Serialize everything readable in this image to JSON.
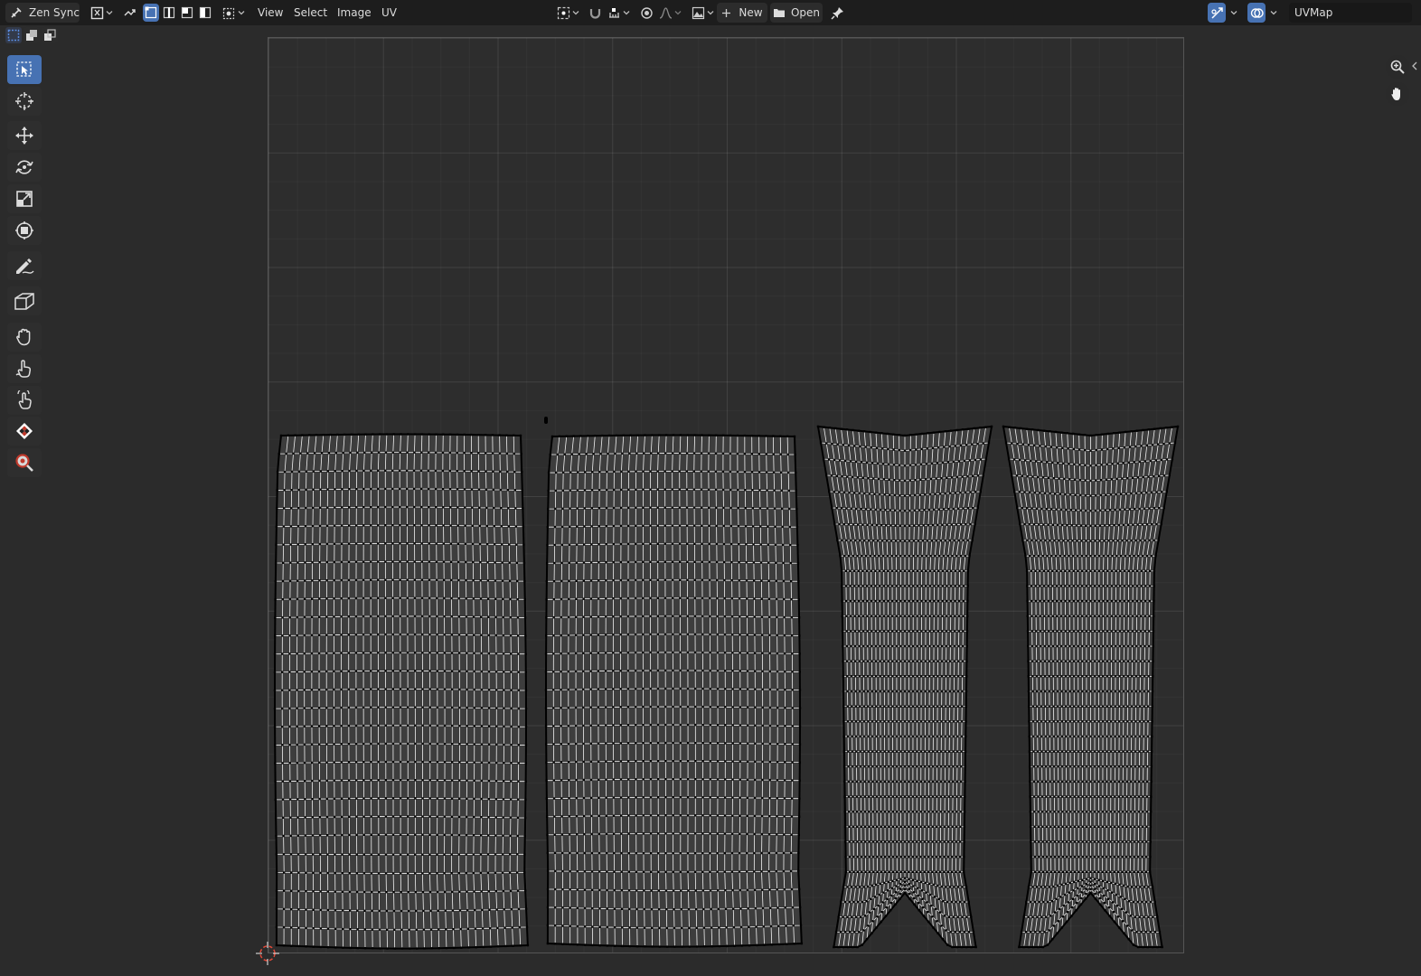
{
  "header": {
    "editor_name": "Zen Sync",
    "menus": [
      "View",
      "Select",
      "Image",
      "UV"
    ],
    "image_new_label": "New",
    "image_open_label": "Open",
    "uv_map_name": "UVMap"
  },
  "colors": {
    "header_bg": "#1d1d1d",
    "viewport_bg": "#2b2b2b",
    "active_tool": "#4772b3",
    "uv_face_fill": "#3d3d3d",
    "uv_edge": "#f0f0f0",
    "uv_vertex": "#000000",
    "cursor": "#e04a3a"
  },
  "toolbar": {
    "tools": [
      "select-box-tool",
      "cursor-tool",
      "move-tool",
      "rotate-tool",
      "scale-tool",
      "transform-tool",
      "annotate-tool",
      "rip-region-tool",
      "grab-tool",
      "relax-tool",
      "pinch-tool",
      "zen-checker-tool",
      "zoom-tool"
    ],
    "active_tool": "select-box-tool"
  },
  "uv_islands": [
    {
      "name": "left-panel",
      "shape": "rectangle",
      "columns": 34,
      "rows": 28
    },
    {
      "name": "right-panel",
      "shape": "rectangle",
      "columns": 34,
      "rows": 28
    },
    {
      "name": "left-leg",
      "shape": "v-notched-leg",
      "columns": 30,
      "rows": 34
    },
    {
      "name": "right-leg",
      "shape": "v-notched-leg",
      "columns": 30,
      "rows": 34
    }
  ]
}
